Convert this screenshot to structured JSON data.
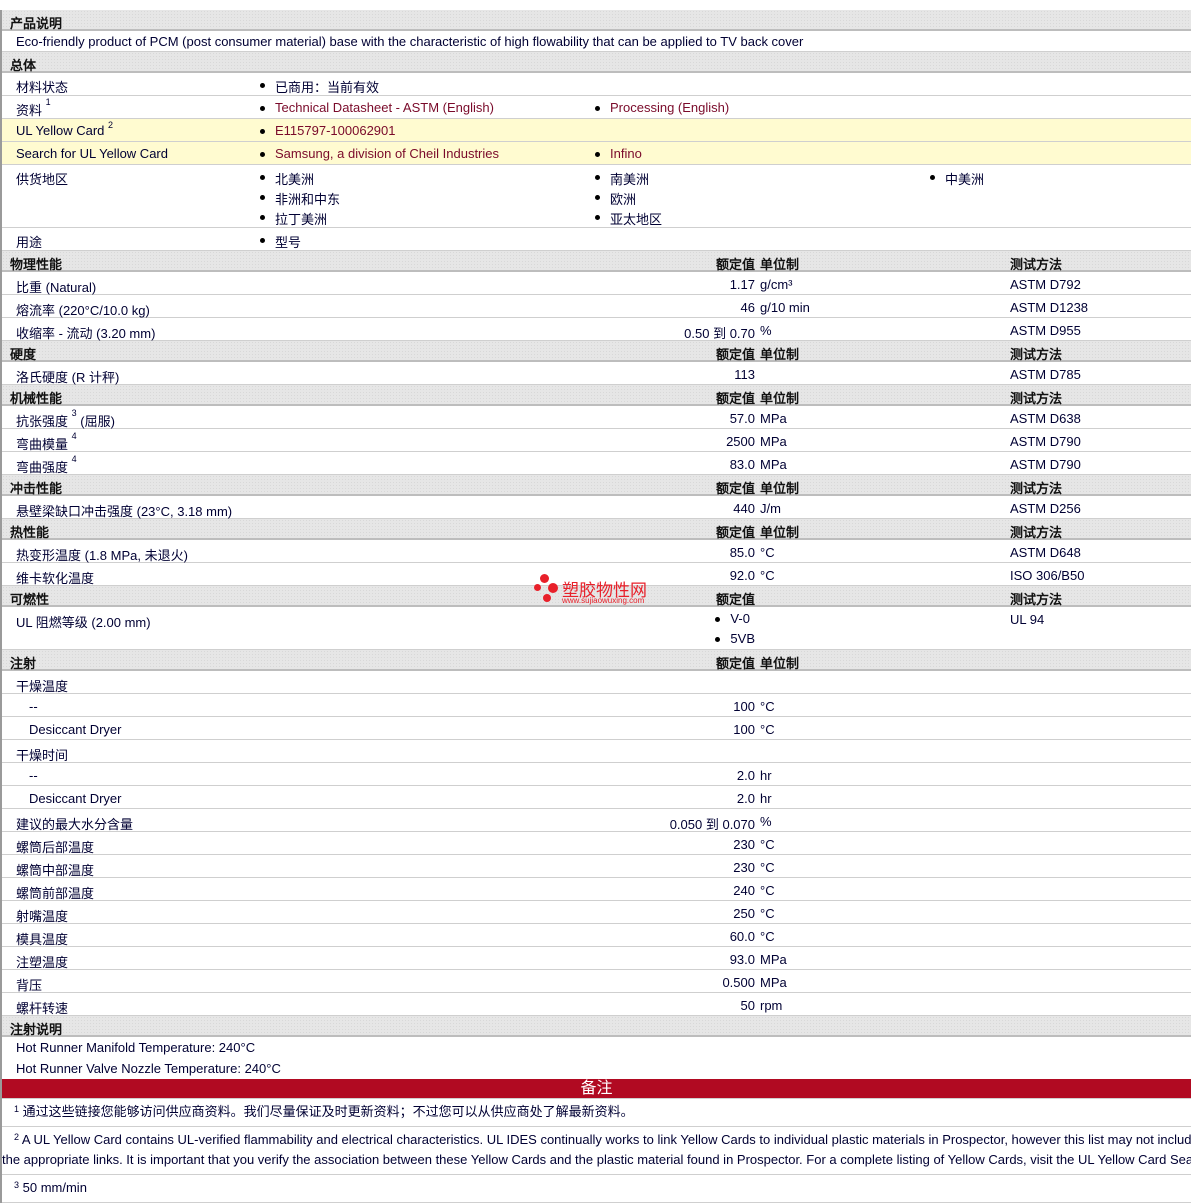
{
  "rows": [
    {
      "type": "header",
      "label": "产品说明"
    },
    {
      "type": "text",
      "text": "Eco-friendly product of PCM (post consumer material) base with the characteristic of high flowability that can be applied to TV back cover"
    },
    {
      "type": "header",
      "label": "总体"
    },
    {
      "type": "bullets",
      "label": "材料状态",
      "cols": [
        [
          "已商用：当前有效"
        ]
      ]
    },
    {
      "type": "bullets",
      "label": "资料",
      "sup": "1",
      "link": true,
      "cols": [
        [
          "Technical Datasheet - ASTM (English)"
        ],
        [
          "Processing (English)"
        ]
      ]
    },
    {
      "type": "bullets",
      "label": "UL Yellow Card",
      "sup": "2",
      "link": true,
      "yellow": true,
      "cols": [
        [
          "E115797-100062901"
        ]
      ]
    },
    {
      "type": "bullets",
      "label": "Search for UL Yellow Card",
      "link": true,
      "yellow": true,
      "cols": [
        [
          "Samsung, a division of Cheil Industries"
        ],
        [
          "Infino"
        ]
      ]
    },
    {
      "type": "bullets",
      "label": "供货地区",
      "cols": [
        [
          "北美洲",
          "非洲和中东",
          "拉丁美洲"
        ],
        [
          "南美洲",
          "欧洲",
          "亚太地区"
        ],
        [
          "中美洲"
        ]
      ]
    },
    {
      "type": "bullets",
      "label": "用途",
      "cols": [
        [
          "型号"
        ]
      ]
    },
    {
      "type": "header",
      "label": "物理性能",
      "h1": "额定值",
      "h2": "单位制",
      "h3": "测试方法"
    },
    {
      "type": "prop",
      "label": "比重  (Natural)",
      "value": "1.17",
      "unit": "g/cm³",
      "method": "ASTM D792"
    },
    {
      "type": "prop",
      "label": "熔流率  (220°C/10.0 kg)",
      "value": "46",
      "unit": "g/10 min",
      "method": "ASTM D1238"
    },
    {
      "type": "prop",
      "label": "收缩率  - 流动  (3.20 mm)",
      "value": "0.50 到  0.70",
      "unit": "%",
      "method": "ASTM D955"
    },
    {
      "type": "header",
      "label": "硬度",
      "h1": "额定值",
      "h2": "单位制",
      "h3": "测试方法"
    },
    {
      "type": "prop",
      "label": "洛氏硬度  (R 计秤)",
      "value": "113",
      "unit": "",
      "method": "ASTM D785"
    },
    {
      "type": "header",
      "label": "机械性能",
      "h1": "额定值",
      "h2": "单位制",
      "h3": "测试方法"
    },
    {
      "type": "prop",
      "label": "抗张强度",
      "sup": "3",
      "after": " (屈服)",
      "value": "57.0",
      "unit": "MPa",
      "method": "ASTM D638"
    },
    {
      "type": "prop",
      "label": "弯曲模量",
      "sup": "4",
      "value": "2500",
      "unit": "MPa",
      "method": "ASTM D790"
    },
    {
      "type": "prop",
      "label": "弯曲强度",
      "sup": "4",
      "value": "83.0",
      "unit": "MPa",
      "method": "ASTM D790"
    },
    {
      "type": "header",
      "label": "冲击性能",
      "h1": "额定值",
      "h2": "单位制",
      "h3": "测试方法"
    },
    {
      "type": "prop",
      "label": "悬壁梁缺口冲击强度  (23°C, 3.18 mm)",
      "value": "440",
      "unit": "J/m",
      "method": "ASTM D256"
    },
    {
      "type": "header",
      "label": "热性能",
      "h1": "额定值",
      "h2": "单位制",
      "h3": "测试方法"
    },
    {
      "type": "prop",
      "label": "热变形温度  (1.8 MPa, 未退火)",
      "value": "85.0",
      "unit": "°C",
      "method": "ASTM D648"
    },
    {
      "type": "prop",
      "label": "维卡软化温度",
      "value": "92.0",
      "unit": "°C",
      "method": "ISO 306/B50"
    },
    {
      "type": "header",
      "label": "可燃性",
      "h1": "额定值",
      "h3": "测试方法"
    },
    {
      "type": "flam",
      "label": "UL 阻燃等级  (2.00 mm)",
      "values": [
        "V-0",
        "5VB"
      ],
      "method": "UL 94"
    },
    {
      "type": "header",
      "label": "注射",
      "h1": "额定值",
      "h2": "单位制"
    },
    {
      "type": "prop",
      "label": "干燥温度"
    },
    {
      "type": "prop",
      "label": "--",
      "indent": true,
      "value": "100",
      "unit": "°C"
    },
    {
      "type": "prop",
      "label": "Desiccant Dryer",
      "indent": true,
      "value": "100",
      "unit": "°C"
    },
    {
      "type": "prop",
      "label": "干燥时间"
    },
    {
      "type": "prop",
      "label": "--",
      "indent": true,
      "value": "2.0",
      "unit": "hr"
    },
    {
      "type": "prop",
      "label": "Desiccant Dryer",
      "indent": true,
      "value": "2.0",
      "unit": "hr"
    },
    {
      "type": "prop",
      "label": "建议的最大水分含量",
      "value": "0.050 到  0.070",
      "unit": "%"
    },
    {
      "type": "prop",
      "label": "螺筒后部温度",
      "value": "230",
      "unit": "°C"
    },
    {
      "type": "prop",
      "label": "螺筒中部温度",
      "value": "230",
      "unit": "°C"
    },
    {
      "type": "prop",
      "label": "螺筒前部温度",
      "value": "240",
      "unit": "°C"
    },
    {
      "type": "prop",
      "label": "射嘴温度",
      "value": "250",
      "unit": "°C"
    },
    {
      "type": "prop",
      "label": "模具温度",
      "value": "60.0",
      "unit": "°C"
    },
    {
      "type": "prop",
      "label": "注塑温度",
      "value": "93.0",
      "unit": "MPa"
    },
    {
      "type": "prop",
      "label": "背压",
      "value": "0.500",
      "unit": "MPa"
    },
    {
      "type": "prop",
      "label": "螺杆转速",
      "value": "50",
      "unit": "rpm"
    },
    {
      "type": "header",
      "label": "注射说明"
    },
    {
      "type": "text",
      "text": "Hot Runner Manifold Temperature: 240°C",
      "noline": true
    },
    {
      "type": "text",
      "text": "Hot Runner Valve Nozzle Temperature: 240°C",
      "noline": true
    },
    {
      "type": "red",
      "label": "备注"
    },
    {
      "type": "note",
      "num": "1",
      "text": "通过这些链接您能够访问供应商资料。我们尽量保证及时更新资料；不过您可以从供应商处了解最新资料。"
    },
    {
      "type": "note",
      "num": "2",
      "wrap": true,
      "text": "A UL Yellow Card contains UL-verified flammability and electrical characteristics. UL IDES continually works to link Yellow Cards to individual plastic materials in Prospector, however this list may not include all of the appropriate links. It is important that you verify the association between these Yellow Cards and the plastic material found in Prospector. For a complete listing of Yellow Cards, visit the UL Yellow Card Search."
    },
    {
      "type": "note",
      "num": "3",
      "text": "50 mm/min"
    }
  ],
  "logo": {
    "name": "塑胶物性网",
    "url": "www.sujiaowuxing.com"
  },
  "colors": {
    "link": "#7a0a2a",
    "banner": "#b10a22",
    "yellow": "#fffbd0"
  }
}
